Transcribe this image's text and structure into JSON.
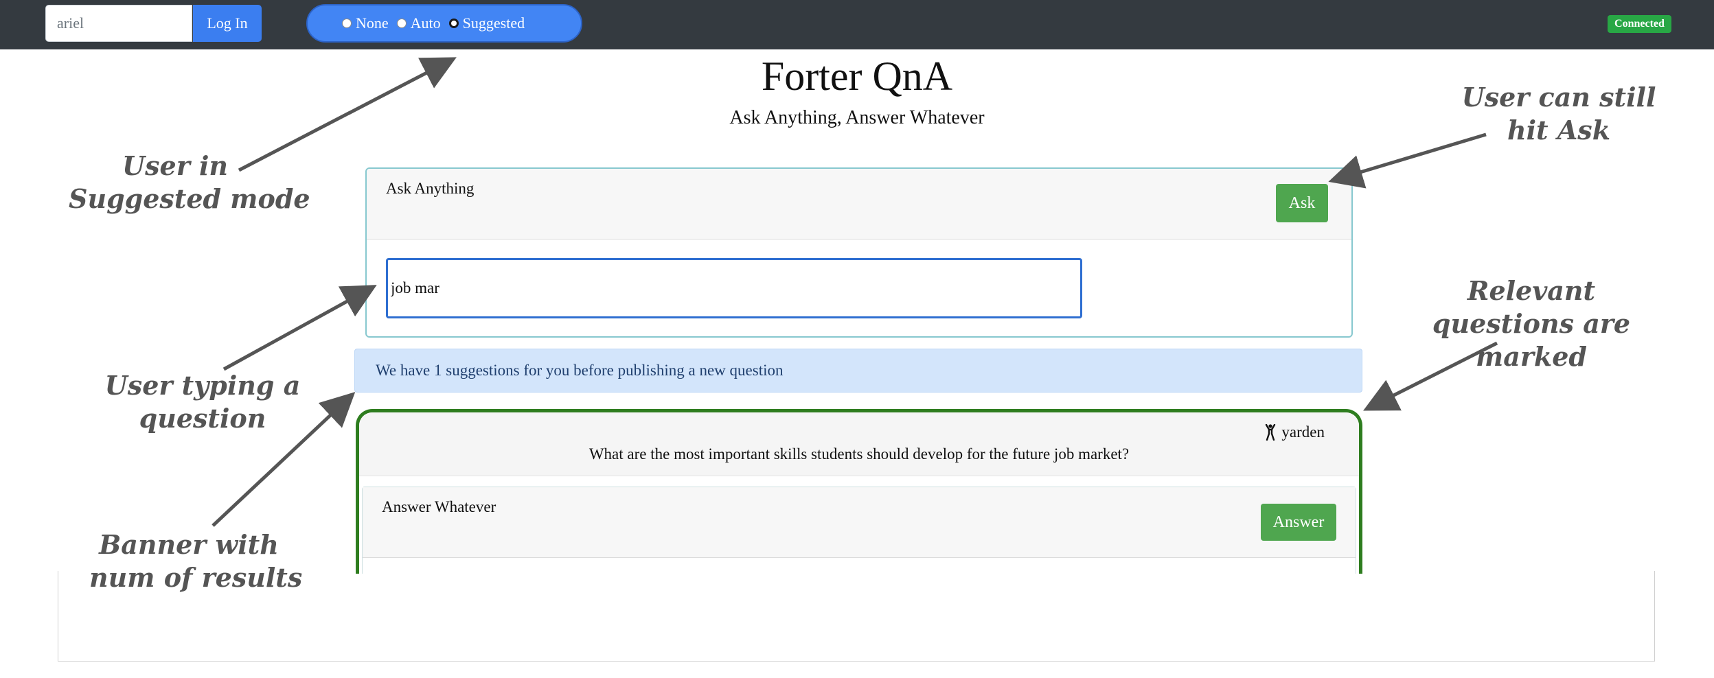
{
  "topbar": {
    "username_value": "ariel",
    "login_label": "Log In",
    "modes": [
      {
        "label": "None",
        "checked": false
      },
      {
        "label": "Auto",
        "checked": false
      },
      {
        "label": "Suggested",
        "checked": true
      }
    ],
    "status": "Connected"
  },
  "page": {
    "title": "Forter QnA",
    "subtitle": "Ask Anything, Answer Whatever"
  },
  "ask": {
    "header": "Ask Anything",
    "button_label": "Ask",
    "input_value": "job mar"
  },
  "banner": {
    "text": "We have 1 suggestions for you before publishing a new question"
  },
  "suggestion": {
    "author": "yarden",
    "author_icon": "person-icon",
    "question": "What are the most important skills students should develop for the future job market?",
    "answer_header": "Answer Whatever",
    "answer_button": "Answer"
  },
  "annotations": {
    "suggested_mode": [
      "User in",
      "Suggested mode"
    ],
    "typing": [
      "User typing a",
      "question"
    ],
    "banner": [
      "Banner with",
      "num of results"
    ],
    "hit_ask": [
      "User can still",
      "hit Ask"
    ],
    "relevant": [
      "Relevant",
      "questions are",
      "marked"
    ]
  },
  "colors": {
    "topbar": "#343a40",
    "primary": "#3b7ef0",
    "success": "#4fa64f",
    "marked_border": "#2e7d1f",
    "banner_bg": "#d3e5fb"
  }
}
